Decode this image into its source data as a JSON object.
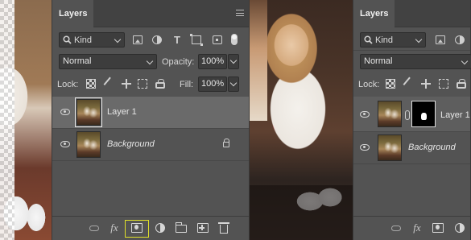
{
  "panels": {
    "left": {
      "tab_title": "Layers",
      "filter": {
        "label": "Kind"
      },
      "blend_mode": "Normal",
      "opacity_label": "Opacity:",
      "opacity_value": "100%",
      "lock_label": "Lock:",
      "fill_label": "Fill:",
      "fill_value": "100%",
      "layers": [
        {
          "name": "Layer 1",
          "selected": true
        },
        {
          "name": "Background",
          "locked": true
        }
      ],
      "footer_icons": [
        "link-icon",
        "fx-icon",
        "add-mask-icon",
        "adjustment-icon",
        "folder-icon",
        "new-layer-icon",
        "trash-icon"
      ],
      "fx_label": "fx"
    },
    "right": {
      "tab_title": "Layers",
      "filter": {
        "label": "Kind"
      },
      "blend_mode": "Normal",
      "lock_label": "Lock:",
      "layers": [
        {
          "name": "Layer 1",
          "has_mask": true
        },
        {
          "name": "Background"
        }
      ],
      "fx_label": "fx"
    }
  },
  "colors": {
    "panel_bg": "#535353",
    "selected_row": "#6a6a6a",
    "mask_button_highlight": "#e0e02a"
  }
}
